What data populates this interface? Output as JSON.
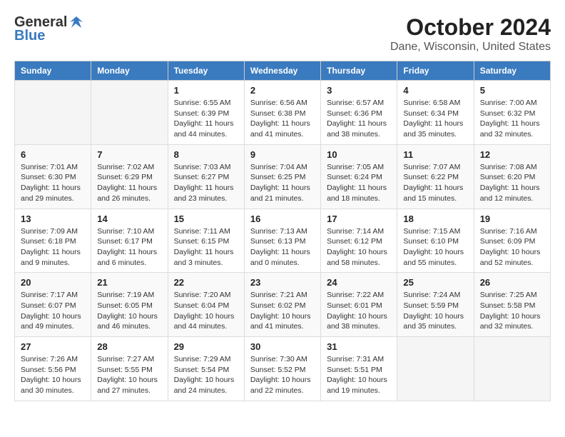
{
  "header": {
    "logo_general": "General",
    "logo_blue": "Blue",
    "month_title": "October 2024",
    "location": "Dane, Wisconsin, United States"
  },
  "calendar": {
    "weekdays": [
      "Sunday",
      "Monday",
      "Tuesday",
      "Wednesday",
      "Thursday",
      "Friday",
      "Saturday"
    ],
    "weeks": [
      [
        {
          "day": "",
          "info": ""
        },
        {
          "day": "",
          "info": ""
        },
        {
          "day": "1",
          "info": "Sunrise: 6:55 AM\nSunset: 6:39 PM\nDaylight: 11 hours and 44 minutes."
        },
        {
          "day": "2",
          "info": "Sunrise: 6:56 AM\nSunset: 6:38 PM\nDaylight: 11 hours and 41 minutes."
        },
        {
          "day": "3",
          "info": "Sunrise: 6:57 AM\nSunset: 6:36 PM\nDaylight: 11 hours and 38 minutes."
        },
        {
          "day": "4",
          "info": "Sunrise: 6:58 AM\nSunset: 6:34 PM\nDaylight: 11 hours and 35 minutes."
        },
        {
          "day": "5",
          "info": "Sunrise: 7:00 AM\nSunset: 6:32 PM\nDaylight: 11 hours and 32 minutes."
        }
      ],
      [
        {
          "day": "6",
          "info": "Sunrise: 7:01 AM\nSunset: 6:30 PM\nDaylight: 11 hours and 29 minutes."
        },
        {
          "day": "7",
          "info": "Sunrise: 7:02 AM\nSunset: 6:29 PM\nDaylight: 11 hours and 26 minutes."
        },
        {
          "day": "8",
          "info": "Sunrise: 7:03 AM\nSunset: 6:27 PM\nDaylight: 11 hours and 23 minutes."
        },
        {
          "day": "9",
          "info": "Sunrise: 7:04 AM\nSunset: 6:25 PM\nDaylight: 11 hours and 21 minutes."
        },
        {
          "day": "10",
          "info": "Sunrise: 7:05 AM\nSunset: 6:24 PM\nDaylight: 11 hours and 18 minutes."
        },
        {
          "day": "11",
          "info": "Sunrise: 7:07 AM\nSunset: 6:22 PM\nDaylight: 11 hours and 15 minutes."
        },
        {
          "day": "12",
          "info": "Sunrise: 7:08 AM\nSunset: 6:20 PM\nDaylight: 11 hours and 12 minutes."
        }
      ],
      [
        {
          "day": "13",
          "info": "Sunrise: 7:09 AM\nSunset: 6:18 PM\nDaylight: 11 hours and 9 minutes."
        },
        {
          "day": "14",
          "info": "Sunrise: 7:10 AM\nSunset: 6:17 PM\nDaylight: 11 hours and 6 minutes."
        },
        {
          "day": "15",
          "info": "Sunrise: 7:11 AM\nSunset: 6:15 PM\nDaylight: 11 hours and 3 minutes."
        },
        {
          "day": "16",
          "info": "Sunrise: 7:13 AM\nSunset: 6:13 PM\nDaylight: 11 hours and 0 minutes."
        },
        {
          "day": "17",
          "info": "Sunrise: 7:14 AM\nSunset: 6:12 PM\nDaylight: 10 hours and 58 minutes."
        },
        {
          "day": "18",
          "info": "Sunrise: 7:15 AM\nSunset: 6:10 PM\nDaylight: 10 hours and 55 minutes."
        },
        {
          "day": "19",
          "info": "Sunrise: 7:16 AM\nSunset: 6:09 PM\nDaylight: 10 hours and 52 minutes."
        }
      ],
      [
        {
          "day": "20",
          "info": "Sunrise: 7:17 AM\nSunset: 6:07 PM\nDaylight: 10 hours and 49 minutes."
        },
        {
          "day": "21",
          "info": "Sunrise: 7:19 AM\nSunset: 6:05 PM\nDaylight: 10 hours and 46 minutes."
        },
        {
          "day": "22",
          "info": "Sunrise: 7:20 AM\nSunset: 6:04 PM\nDaylight: 10 hours and 44 minutes."
        },
        {
          "day": "23",
          "info": "Sunrise: 7:21 AM\nSunset: 6:02 PM\nDaylight: 10 hours and 41 minutes."
        },
        {
          "day": "24",
          "info": "Sunrise: 7:22 AM\nSunset: 6:01 PM\nDaylight: 10 hours and 38 minutes."
        },
        {
          "day": "25",
          "info": "Sunrise: 7:24 AM\nSunset: 5:59 PM\nDaylight: 10 hours and 35 minutes."
        },
        {
          "day": "26",
          "info": "Sunrise: 7:25 AM\nSunset: 5:58 PM\nDaylight: 10 hours and 32 minutes."
        }
      ],
      [
        {
          "day": "27",
          "info": "Sunrise: 7:26 AM\nSunset: 5:56 PM\nDaylight: 10 hours and 30 minutes."
        },
        {
          "day": "28",
          "info": "Sunrise: 7:27 AM\nSunset: 5:55 PM\nDaylight: 10 hours and 27 minutes."
        },
        {
          "day": "29",
          "info": "Sunrise: 7:29 AM\nSunset: 5:54 PM\nDaylight: 10 hours and 24 minutes."
        },
        {
          "day": "30",
          "info": "Sunrise: 7:30 AM\nSunset: 5:52 PM\nDaylight: 10 hours and 22 minutes."
        },
        {
          "day": "31",
          "info": "Sunrise: 7:31 AM\nSunset: 5:51 PM\nDaylight: 10 hours and 19 minutes."
        },
        {
          "day": "",
          "info": ""
        },
        {
          "day": "",
          "info": ""
        }
      ]
    ]
  }
}
